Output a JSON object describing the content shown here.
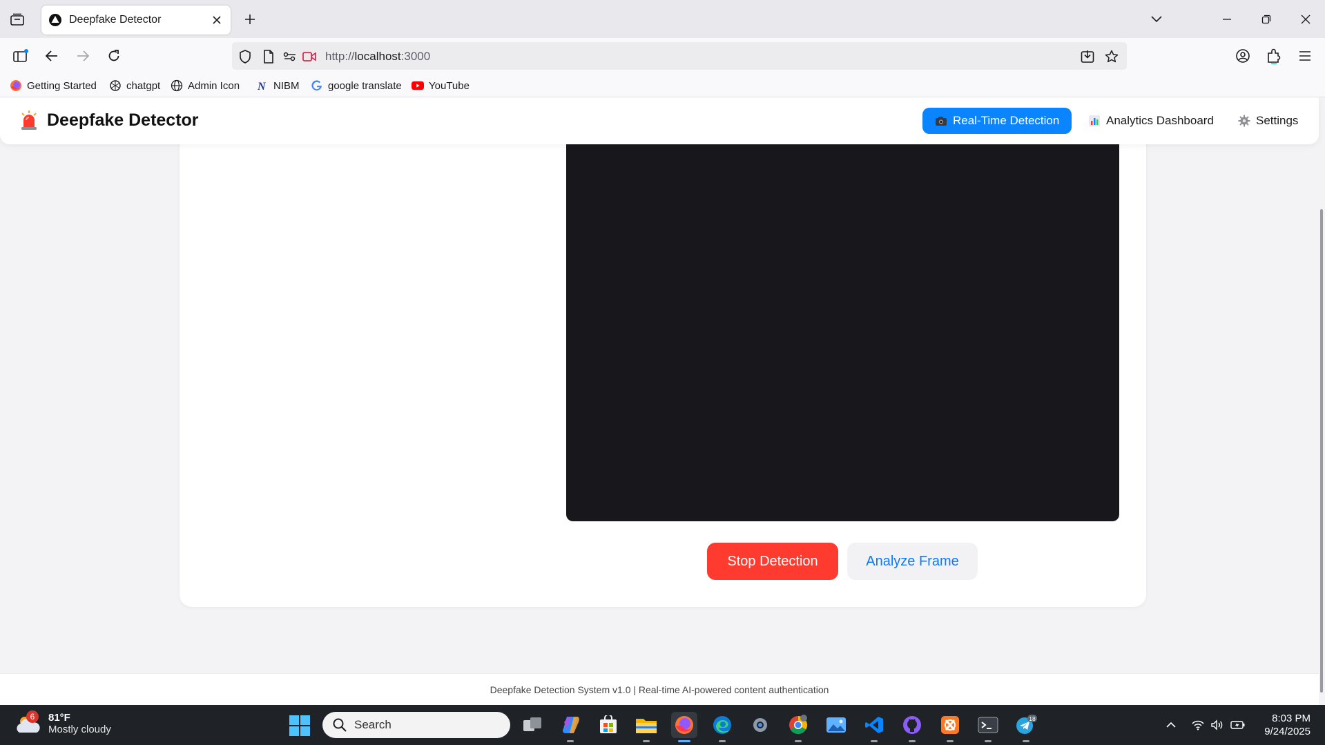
{
  "browser": {
    "tab_title": "Deepfake Detector",
    "url_scheme": "http://",
    "url_host": "localhost",
    "url_port": ":3000",
    "bookmarks": [
      {
        "label": "Getting Started",
        "icon": "firefox-icon"
      },
      {
        "label": "chatgpt",
        "icon": "chatgpt-icon"
      },
      {
        "label": "Admin Icon",
        "icon": "globe-icon"
      },
      {
        "label": "NIBM",
        "icon": "nibm-icon"
      },
      {
        "label": "google translate",
        "icon": "google-icon"
      },
      {
        "label": "YouTube",
        "icon": "youtube-icon"
      }
    ]
  },
  "app": {
    "title": "Deepfake Detector",
    "nav": [
      {
        "label": "Real-Time Detection",
        "icon": "camera-icon",
        "active": true
      },
      {
        "label": "Analytics Dashboard",
        "icon": "bar-chart-icon",
        "active": false
      },
      {
        "label": "Settings",
        "icon": "gear-icon",
        "active": false
      }
    ],
    "buttons": {
      "stop": "Stop Detection",
      "analyze": "Analyze Frame"
    },
    "footer": "Deepfake Detection System v1.0 | Real-time AI-powered content authentication",
    "colors": {
      "primary": "#0a84ff",
      "danger": "#ff3b30",
      "video_bg": "#18171b"
    }
  },
  "taskbar": {
    "weather_badge": "6",
    "weather_temp": "81°F",
    "weather_desc": "Mostly cloudy",
    "search_placeholder": "Search",
    "telegram_badge": "18",
    "time": "8:03 PM",
    "date": "9/24/2025"
  }
}
